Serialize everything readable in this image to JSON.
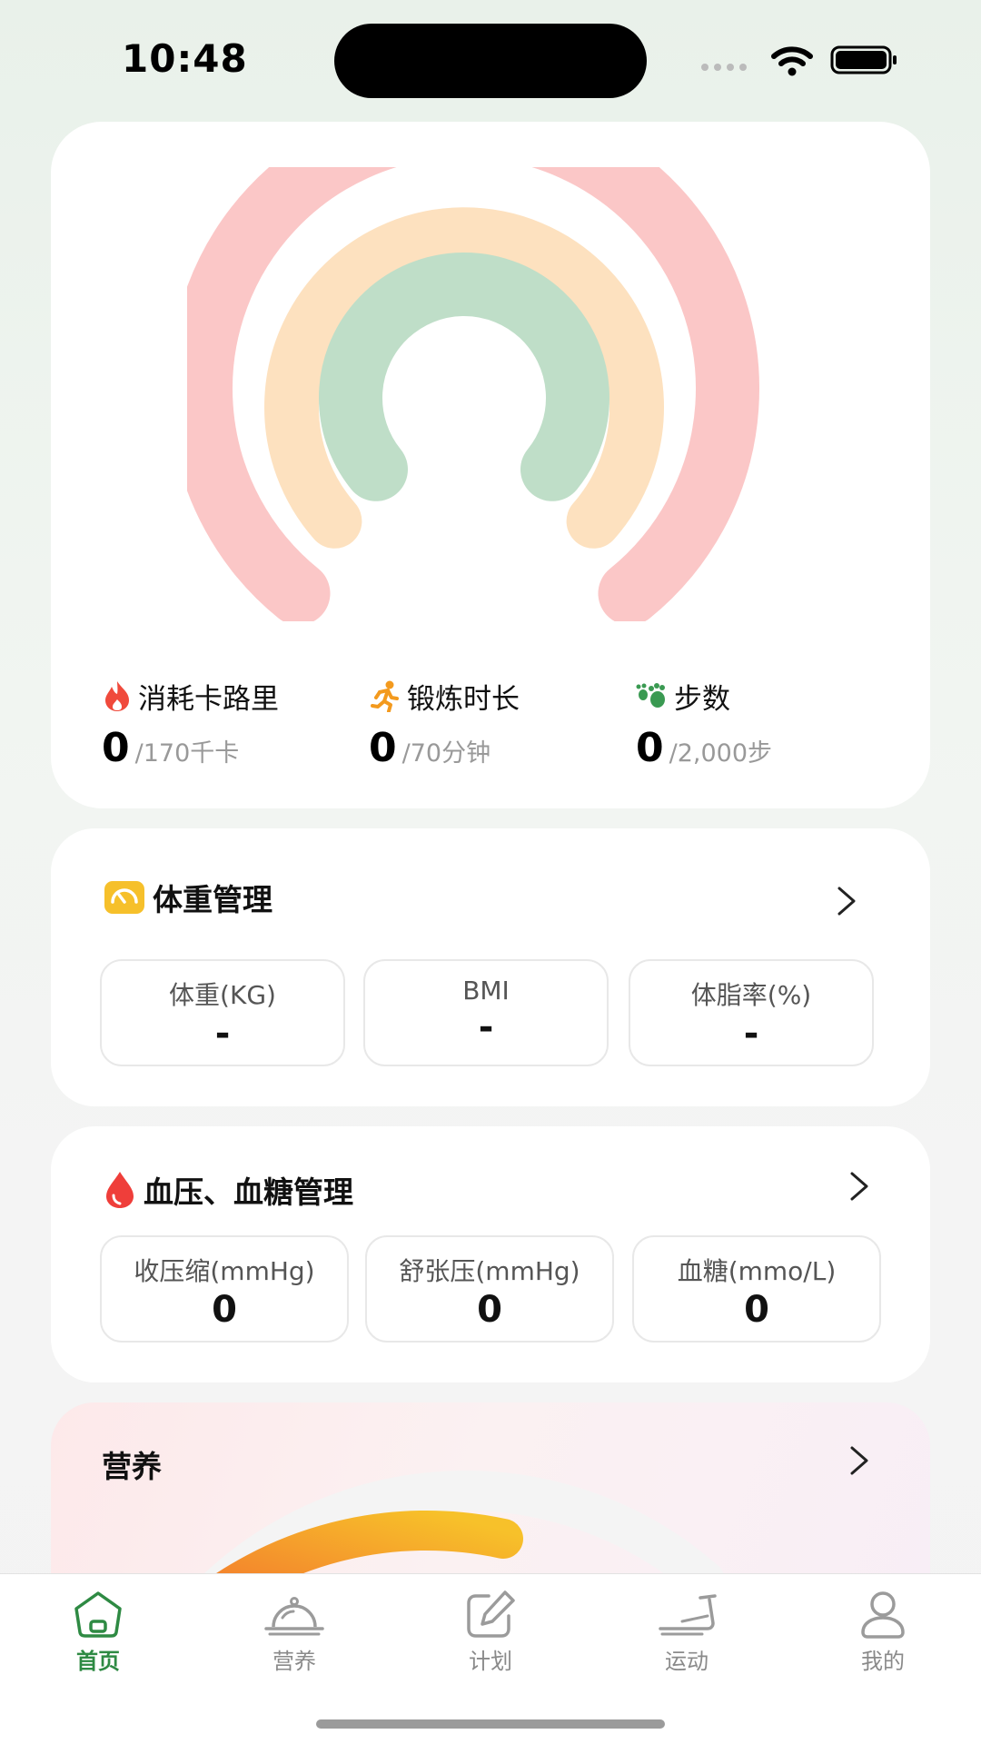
{
  "status_bar": {
    "time": "10:48"
  },
  "activity": {
    "stats": [
      {
        "label": "消耗卡路里",
        "value": "0",
        "goal": "/170千卡",
        "icon": "flame-icon",
        "color": "#f04a3c"
      },
      {
        "label": "锻炼时长",
        "value": "0",
        "goal": "/70分钟",
        "icon": "running-person-icon",
        "color": "#f39a1e"
      },
      {
        "label": "步数",
        "value": "0",
        "goal": "/2,000步",
        "icon": "footprints-icon",
        "color": "#3a9a52"
      }
    ],
    "rings": [
      {
        "name": "calories",
        "color": "#fbc7c7",
        "progress": 0
      },
      {
        "name": "exercise",
        "color": "#fde1bf",
        "progress": 0
      },
      {
        "name": "steps",
        "color": "#bfdec8",
        "progress": 0
      }
    ]
  },
  "weight": {
    "title": "体重管理",
    "icon": "scale-icon",
    "metrics": [
      {
        "label": "体重(KG)",
        "value": "-"
      },
      {
        "label": "BMI",
        "value": "-"
      },
      {
        "label": "体脂率(%)",
        "value": "-"
      }
    ]
  },
  "blood": {
    "title": "血压、血糖管理",
    "icon": "blood-drop-icon",
    "metrics": [
      {
        "label": "收压缩(mmHg)",
        "value": "0"
      },
      {
        "label": "舒张压(mmHg)",
        "value": "0"
      },
      {
        "label": "血糖(mmo/L)",
        "value": "0"
      }
    ]
  },
  "nutrition": {
    "title": "营养"
  },
  "tabs": [
    {
      "label": "首页",
      "icon": "home-icon",
      "active": true
    },
    {
      "label": "营养",
      "icon": "food-cloche-icon",
      "active": false
    },
    {
      "label": "计划",
      "icon": "edit-plan-icon",
      "active": false
    },
    {
      "label": "运动",
      "icon": "treadmill-icon",
      "active": false
    },
    {
      "label": "我的",
      "icon": "profile-icon",
      "active": false
    }
  ],
  "colors": {
    "accent": "#2e8a43",
    "inactive": "#8a8a8a"
  }
}
